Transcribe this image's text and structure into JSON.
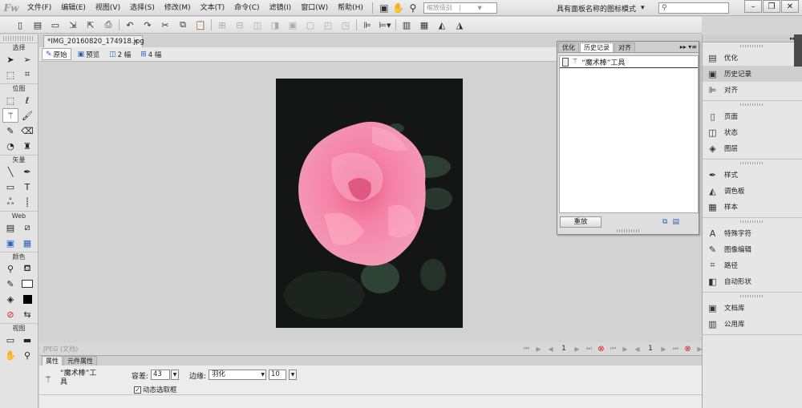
{
  "menubar": {
    "logo": "Fw",
    "items": [
      "文件(F)",
      "编辑(E)",
      "视图(V)",
      "选择(S)",
      "修改(M)",
      "文本(T)",
      "命令(C)",
      "滤镜(I)",
      "窗口(W)",
      "帮助(H)"
    ],
    "zoom_placeholder": "缩放级别",
    "workspace_mode": "具有面板名称的图标模式",
    "workspace_caret": "▾",
    "window_buttons": [
      "–",
      "❐",
      "✕"
    ]
  },
  "document": {
    "tab_title": "*IMG_20160820_174918.jpg",
    "tab_close": "×",
    "view_tabs": [
      {
        "icon": "pencil-icon",
        "label": "原始"
      },
      {
        "icon": "image-icon",
        "label": "预览"
      },
      {
        "icon": "two-up-icon",
        "label": "2 幅"
      },
      {
        "icon": "four-up-icon",
        "label": "4 幅"
      }
    ],
    "active_view": "原始",
    "status_text": "JPEG (文档)",
    "frame_number": "1",
    "frame_number_2": "1"
  },
  "tools_panel": {
    "sections": [
      "选择",
      "位图",
      "矢量",
      "Web",
      "颜色",
      "视图"
    ]
  },
  "history_panel": {
    "tabs": [
      "优化",
      "历史记录",
      "对齐"
    ],
    "active_tab": "历史记录",
    "menu_glyph": "▸▸ ▾≡",
    "entries": [
      "“魔术棒”工具"
    ],
    "replay_label": "重放"
  },
  "right_dock": {
    "groups": [
      [
        {
          "label": "优化",
          "icon": "optimize-icon"
        },
        {
          "label": "历史记录",
          "icon": "history-icon"
        },
        {
          "label": "对齐",
          "icon": "align-icon"
        }
      ],
      [
        {
          "label": "页面",
          "icon": "pages-icon"
        },
        {
          "label": "状态",
          "icon": "states-icon"
        },
        {
          "label": "图层",
          "icon": "layers-icon"
        }
      ],
      [
        {
          "label": "样式",
          "icon": "styles-icon"
        },
        {
          "label": "调色板",
          "icon": "palette-icon"
        },
        {
          "label": "样本",
          "icon": "swatches-icon"
        }
      ],
      [
        {
          "label": "特殊字符",
          "icon": "special-chars-icon"
        },
        {
          "label": "图像编辑",
          "icon": "image-edit-icon"
        },
        {
          "label": "路径",
          "icon": "path-icon"
        },
        {
          "label": "自动形状",
          "icon": "auto-shape-icon"
        }
      ],
      [
        {
          "label": "文档库",
          "icon": "doc-library-icon"
        },
        {
          "label": "公用库",
          "icon": "common-library-icon"
        }
      ]
    ],
    "active_item": "历史记录"
  },
  "properties": {
    "tabs": [
      "属性",
      "元件属性"
    ],
    "active_tab": "属性",
    "tool_name": "“魔术棒”工具",
    "tolerance_label": "容差:",
    "tolerance_value": "43",
    "edge_label": "边缘:",
    "edge_value": "羽化",
    "feather_value": "10",
    "live_marquee_label": "动态选取框",
    "live_marquee_checked": true
  },
  "colors": {
    "accent": "#2a63c0",
    "stop": "#d01c1c",
    "canvas_bg": "#d2d2d2",
    "photo_bg": "#141615",
    "rose": "#f07fa4"
  }
}
